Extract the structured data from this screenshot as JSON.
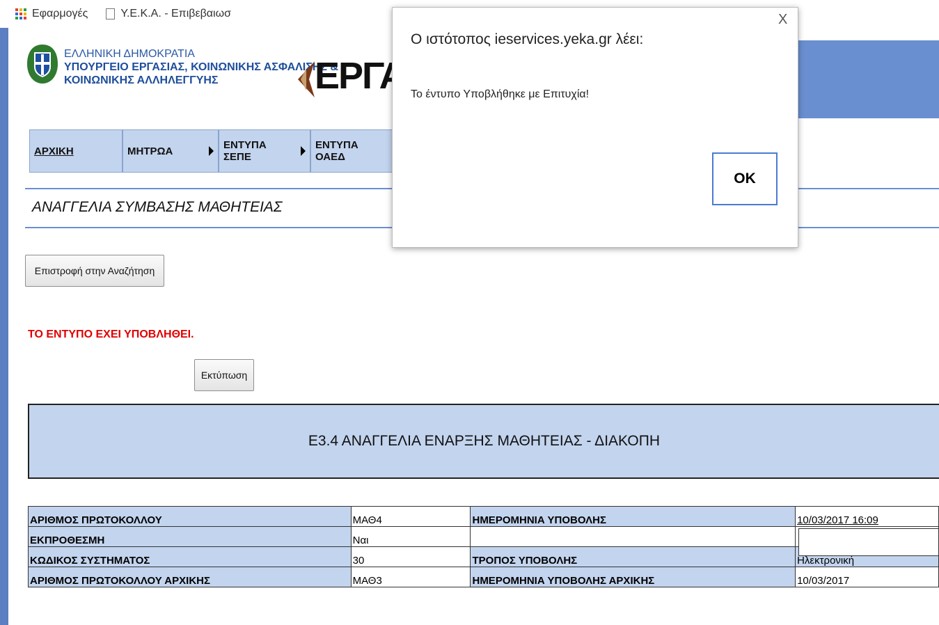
{
  "bookmarks": {
    "apps_label": "Εφαρμογές",
    "page_label": "Υ.Ε.Κ.Α. - Επιβεβαιωσ"
  },
  "header": {
    "ministry_line1": "ΕΛΛΗΝΙΚΗ ΔΗΜΟΚΡΑΤΙΑ",
    "ministry_line2": "ΥΠΟΥΡΓΕΙΟ ΕΡΓΑΣΙΑΣ, ΚΟΙΝΩΝΙΚΗΣ ΑΣΦΑΛΙΣΗΣ &",
    "ministry_line3": "ΚΟΙΝΩΝΙΚΗΣ ΑΛΛΗΛΕΓΓΥΗΣ",
    "logo_text": "ΕΡΓΑΝΗ"
  },
  "nav": {
    "home": "ΑΡΧΙΚΗ",
    "registry": "ΜΗΤΡΩΑ",
    "sepe_forms": "ΕΝΤΥΠΑ ΣΕΠΕ",
    "oaed_forms": "ΕΝΤΥΠΑ ΟΑΕΔ"
  },
  "page": {
    "title": "ΑΝΑΓΓΕΛΙΑ ΣΥΜΒΑΣΗΣ ΜΑΘΗΤΕΙΑΣ",
    "back_button": "Επιστροφή στην Αναζήτηση",
    "status_message": "ΤΟ ΕΝΤΥΠΟ ΕΧΕΙ ΥΠΟΒΛΗΘΕΙ.",
    "print_button": "Εκτύπωση",
    "form_title": "Ε3.4 ΑΝΑΓΓΕΛΙΑ ΕΝΑΡΞΗΣ ΜΑΘΗΤΕΙΑΣ - ΔΙΑΚΟΠΗ"
  },
  "table": {
    "rows": [
      {
        "label1": "ΑΡΙΘΜΟΣ ΠΡΩΤΟΚΟΛΛΟΥ",
        "value1": "ΜΑΘ4",
        "label2": "ΗΜΕΡΟΜΗΝΙΑ ΥΠΟΒΟΛΗΣ",
        "value2": "10/03/2017 16:09"
      },
      {
        "label1": "ΕΚΠΡΟΘΕΣΜΗ",
        "value1": "Ναι",
        "label2": "",
        "value2": ""
      },
      {
        "label1": "ΚΩΔΙΚΟΣ ΣΥΣΤΗΜΑΤΟΣ",
        "value1": "30",
        "label2": "ΤΡΟΠΟΣ ΥΠΟΒΟΛΗΣ",
        "value2": "Ηλεκτρονική"
      },
      {
        "label1": "ΑΡΙΘΜΟΣ ΠΡΩΤΟΚΟΛΛΟΥ ΑΡΧΙΚΗΣ",
        "value1": "ΜΑΘ3",
        "label2": "ΗΜΕΡΟΜΗΝΙΑ ΥΠΟΒΟΛΗΣ ΑΡΧΙΚΗΣ",
        "value2": "10/03/2017"
      }
    ]
  },
  "dialog": {
    "title": "Ο ιστότοπος ieservices.yeka.gr λέει:",
    "message": "Το έντυπο Υποβλήθηκε με Επιτυχία!",
    "ok_button": "OK",
    "close_label": "X"
  },
  "colors": {
    "header_blue": "#6a8fd0",
    "nav_bg": "#c3d4ee",
    "status_red": "#e00000",
    "ok_border": "#4b7ad4"
  }
}
